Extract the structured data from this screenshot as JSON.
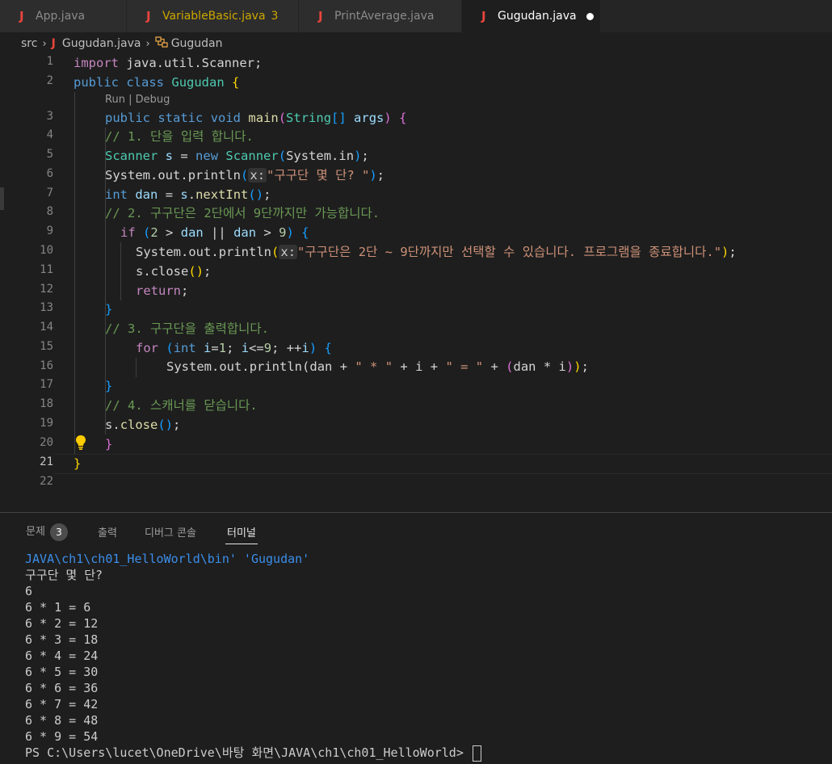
{
  "tabs": [
    {
      "icon": "J",
      "name": "App.java",
      "count": "",
      "modified": false,
      "active": false,
      "warn": false
    },
    {
      "icon": "J",
      "name": "VariableBasic.java",
      "count": "3",
      "modified": false,
      "active": false,
      "warn": true
    },
    {
      "icon": "J",
      "name": "PrintAverage.java",
      "count": "",
      "modified": false,
      "active": false,
      "warn": false
    },
    {
      "icon": "J",
      "name": "Gugudan.java",
      "count": "",
      "modified": true,
      "active": true,
      "warn": false
    }
  ],
  "breadcrumb": {
    "folder": "src",
    "file_icon": "J",
    "file": "Gugudan.java",
    "symbol": "Gugudan"
  },
  "codelens": {
    "run": "Run",
    "divider": "|",
    "debug": "Debug"
  },
  "line_numbers": [
    "1",
    "2",
    "3",
    "4",
    "5",
    "6",
    "7",
    "8",
    "9",
    "10",
    "11",
    "12",
    "13",
    "14",
    "15",
    "16",
    "17",
    "18",
    "19",
    "20",
    "21",
    "22"
  ],
  "active_line": "21",
  "code": {
    "l1_import": "import",
    "l1_pkg": "java.util.Scanner;",
    "l2_public": "public",
    "l2_class": "class",
    "l2_name": "Gugudan",
    "l2_brace": "{",
    "l3_public": "public",
    "l3_static": "static",
    "l3_void": "void",
    "l3_main": "main",
    "l3_paren_open": "(",
    "l3_type": "String",
    "l3_arr": "[]",
    "l3_args": "args",
    "l3_paren_close": ")",
    "l3_brace": "{",
    "l4_comment": "// 1. 단을 입력 합니다.",
    "l5_type": "Scanner",
    "l5_var": "s",
    "l5_eq": "=",
    "l5_new": "new",
    "l5_ctor": "Scanner",
    "l5_paren_open": "(",
    "l5_arg": "System.in",
    "l5_paren_close": ")",
    "l5_semi": ";",
    "l6_sys": "System",
    "l6_out": "out",
    "l6_fn": "println",
    "l6_paren_open": "(",
    "l6_hint": "x:",
    "l6_str": "\"구구단 몇 단? \"",
    "l6_paren_close": ")",
    "l6_semi": ";",
    "l7_type": "int",
    "l7_var": "dan",
    "l7_eq": "=",
    "l7_obj": "s",
    "l7_fn": "nextInt",
    "l7_parens": "()",
    "l7_semi": ";",
    "l8_comment": "// 2. 구구단은 2단에서 9단까지만 가능합니다.",
    "l9_if": "if",
    "l9_paren_open": "(",
    "l9_n1": "2",
    "l9_gt": ">",
    "l9_dan1": "dan",
    "l9_or": "||",
    "l9_dan2": "dan",
    "l9_gt2": ">",
    "l9_n2": "9",
    "l9_paren_close": ")",
    "l9_brace": "{",
    "l10_sys": "System",
    "l10_out": "out",
    "l10_fn": "println",
    "l10_paren_open": "(",
    "l10_hint": "x:",
    "l10_str": "\"구구단은 2단 ~ 9단까지만 선택할 수 있습니다. 프로그램을 종료합니다.\"",
    "l10_paren_close": ")",
    "l10_semi": ";",
    "l11_obj": "s",
    "l11_fn": "close",
    "l11_parens": "()",
    "l11_semi": ";",
    "l12_return": "return",
    "l12_semi": ";",
    "l13_brace": "}",
    "l14_comment": "// 3. 구구단을 출력합니다.",
    "l15_for": "for",
    "l15_paren_open": "(",
    "l15_int": "int",
    "l15_init_var": "i",
    "l15_init_eq": "=",
    "l15_init_val": "1",
    "l15_semi1": ";",
    "l15_cond_var": "i",
    "l15_cond_op": "<=",
    "l15_cond_val": "9",
    "l15_semi2": ";",
    "l15_inc": "++",
    "l15_inc_var": "i",
    "l15_paren_close": ")",
    "l15_brace": "{",
    "l16_sys": "System",
    "l16_out": "out",
    "l16_fn": "println",
    "l16_paren_open": "(",
    "l16_dan": "dan",
    "l16_plus1": "+",
    "l16_str1": "\" * \"",
    "l16_plus2": "+",
    "l16_i": "i",
    "l16_plus3": "+",
    "l16_str2": "\" = \"",
    "l16_plus4": "+",
    "l16_inner_open": "(",
    "l16_dan2": "dan",
    "l16_mul": "*",
    "l16_i2": "i",
    "l16_inner_close": ")",
    "l16_paren_close": ")",
    "l16_semi": ";",
    "l17_brace": "}",
    "l18_comment": "// 4. 스캐너를 닫습니다.",
    "l19_obj": "s",
    "l19_fn": "close",
    "l19_parens": "()",
    "l19_semi": ";",
    "l20_brace": "}",
    "l21_brace": "}"
  },
  "panel": {
    "tabs": [
      {
        "label": "문제",
        "badge": "3",
        "active": false
      },
      {
        "label": "출력",
        "badge": "",
        "active": false
      },
      {
        "label": "디버그 콘솔",
        "badge": "",
        "active": false
      },
      {
        "label": "터미널",
        "badge": "",
        "active": true
      }
    ]
  },
  "terminal": {
    "path_line": "JAVA\\ch1\\ch01_HelloWorld\\bin' 'Gugudan'",
    "lines": [
      "구구단 몇 단?",
      "6",
      "6 * 1 = 6",
      "6 * 2 = 12",
      "6 * 3 = 18",
      "6 * 4 = 24",
      "6 * 5 = 30",
      "6 * 6 = 36",
      "6 * 7 = 42",
      "6 * 8 = 48",
      "6 * 9 = 54"
    ],
    "prompt": "PS C:\\Users\\lucet\\OneDrive\\바탕 화면\\JAVA\\ch1\\ch01_HelloWorld>"
  },
  "colors": {
    "editor_bg": "#1e1e1e",
    "tab_bar_bg": "#252526",
    "java_icon": "#e8453c",
    "keyword": "#569cd6",
    "control": "#c586c0",
    "type": "#4ec9b0",
    "string": "#ce9178",
    "comment": "#6a9955",
    "terminal_path": "#3b8eea"
  }
}
